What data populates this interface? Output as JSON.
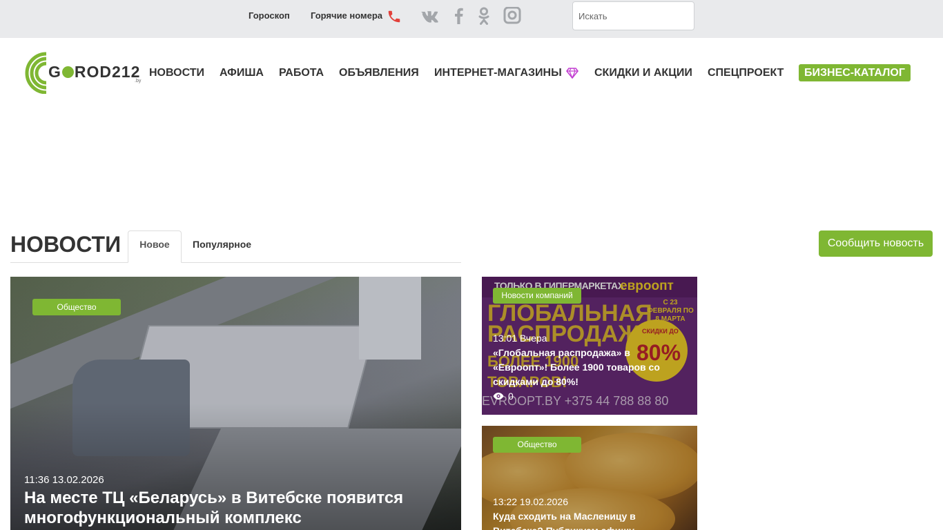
{
  "topbar": {
    "horoscope": "Гороскоп",
    "hotlines": "Горячие номера",
    "social": [
      "vk-icon",
      "facebook-icon",
      "odnoklassniki-icon",
      "instagram-icon"
    ],
    "search_placeholder": "Искать"
  },
  "logo": {
    "text_g": "G",
    "text_rest": "ROD212",
    "by": ".by"
  },
  "nav": {
    "items": [
      "НОВОСТИ",
      "АФИША",
      "РАБОТА",
      "ОБЪЯВЛЕНИЯ",
      "ИНТЕРНЕТ-МАГАЗИНЫ",
      "СКИДКИ И АКЦИИ",
      "СПЕЦПРОЕКТ"
    ],
    "catalog": "БИЗНЕС-КАТАЛОГ"
  },
  "news": {
    "title": "НОВОСТИ",
    "tabs": [
      "Новое",
      "Популярное"
    ],
    "report_button": "Сообщить новость"
  },
  "featured": {
    "tag": "Общество",
    "date": "11:36 13.02.2026",
    "title": "На месте ТЦ «Беларусь» в Витебске появится многофункциональный комплекс"
  },
  "cards": [
    {
      "tag": "Новости компаний",
      "date": "13:01 Вчера",
      "title": "«Глобальная распродажа» в «Евроопт»! Более 1900 товаров со скидками до 80%!",
      "views": "0",
      "banner": {
        "top": "ТОЛЬКО В ГИПЕРМАРКЕТАХ",
        "brand": "евроопт",
        "dates": "С 23 ФЕВРАЛЯ ПО 8 МАРТА",
        "headline": "ГЛОБАЛЬНАЯ РАСПРОДАЖА",
        "more": "БОЛЕЕ 1900 ТОВАРОВ!",
        "discount": "80%",
        "discount_label": "СКИДКИ ДО",
        "footer": "EVROOPT.BY +375 44 788 88 80"
      }
    },
    {
      "tag": "Общество",
      "date": "13:22 19.02.2026",
      "title": "Куда сходить на Масленицу в Витебске? Публикуем афишу"
    }
  ]
}
